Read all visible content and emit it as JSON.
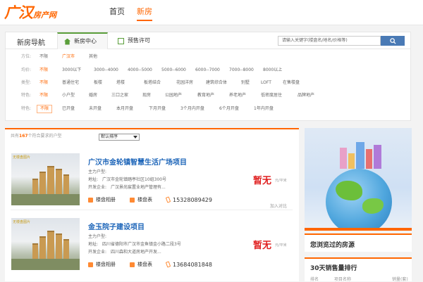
{
  "colors": {
    "accent": "#ff6600",
    "link": "#1a63b8",
    "price": "#e02020",
    "tab_green": "#5a9e3a",
    "search_btn": "#4a7ab5"
  },
  "logo": {
    "big": "广汉",
    "small": "房产网"
  },
  "nav": {
    "items": [
      {
        "label": "首页",
        "active": false
      },
      {
        "label": "新房",
        "active": true
      }
    ]
  },
  "filter": {
    "title": "新房导航",
    "tabs": [
      {
        "label": "新房中心",
        "icon": "home-icon"
      },
      {
        "label": "预售许可",
        "icon": "document-icon"
      }
    ],
    "search_placeholder": "请输入关键字(楼盘名/地名/价格等)",
    "rows": [
      {
        "label": "方位:",
        "options": [
          "不限",
          "广汉市",
          "其他"
        ]
      },
      {
        "label": "均价:",
        "options": [
          "不限",
          "3000以下",
          "3000--4000",
          "4000--5000",
          "5000--6000",
          "6000--7000",
          "7000--8000",
          "8000以上"
        ]
      },
      {
        "label": "类型:",
        "options": [
          "不限",
          "普通住宅",
          "板楼",
          "塔楼",
          "板塔结合",
          "花园洋房",
          "建筑综合体",
          "别墅",
          "LOFT",
          "在售楼盘"
        ]
      },
      {
        "label": "特色:",
        "options": [
          "不限",
          "小户型",
          "婚房",
          "三口之家",
          "现房",
          "公园地产",
          "教育地产",
          "养老地产",
          "低密度居住",
          "品牌地产"
        ]
      },
      {
        "label": "特色:",
        "options": [
          "不限",
          "已开盘",
          "未开盘",
          "本月开盘",
          "下月开盘",
          "3个月内开盘",
          "6个月开盘",
          "1年内开盘"
        ]
      }
    ]
  },
  "list": {
    "count_prefix": "共有",
    "count": "167",
    "count_suffix": "个符合要求的户型",
    "sort": "默认排序",
    "items": [
      {
        "thumb_tag": "无楼盘图片",
        "name": "广汉市金轮镇智慧生活广场项目",
        "type": "主力户型:",
        "address": "地址:　广汉市金轮镇踏亭社区10组300号",
        "developer": "开发企业:　广汉景尚宸置业地产管理有...",
        "actions": [
          "楼盘相册",
          "楼盘表"
        ],
        "phone": "15328089429",
        "price": "暂无",
        "unit": "元/平米",
        "compare": "加入对比"
      },
      {
        "thumb_tag": "无楼盘图片",
        "name": "金玉院子建设项目",
        "type": "主力户型:",
        "address": "地址:　四川省德阳市广汉市金鱼镇金小路二段3号",
        "developer": "开发企业:　四川森和大道房地产开发...",
        "actions": [
          "楼盘相册",
          "楼盘表"
        ],
        "phone": "13684081848",
        "price": "暂无",
        "unit": "元/平米"
      }
    ]
  },
  "sidebar": {
    "viewed_title": "您浏览过的房源",
    "rank_title": "30天销售量排行",
    "rank_cols": [
      "排名",
      "项目名称",
      "销量(套)"
    ]
  }
}
